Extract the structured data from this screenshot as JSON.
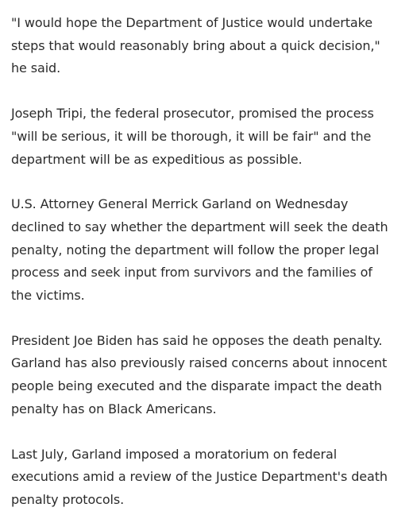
{
  "article": {
    "paragraphs": [
      "\"I would hope the Department of Justice would undertake steps that would reasonably bring about a quick decision,\" he said.",
      "Joseph Tripi, the federal prosecutor, promised the process \"will be serious, it will be thorough, it will be fair\" and the department will be as expeditious as possible.",
      "U.S. Attorney General Merrick Garland on Wednesday declined to say whether the department will seek the death penalty, noting the department will follow the proper legal process and seek input from survivors and the families of the victims.",
      "President Joe Biden has said he opposes the death penalty. Garland has also previously raised concerns about innocent people being executed and the disparate impact the death penalty has on Black Americans.",
      "Last July, Garland imposed a moratorium on federal executions amid a review of the Justice Department's death penalty protocols."
    ]
  }
}
